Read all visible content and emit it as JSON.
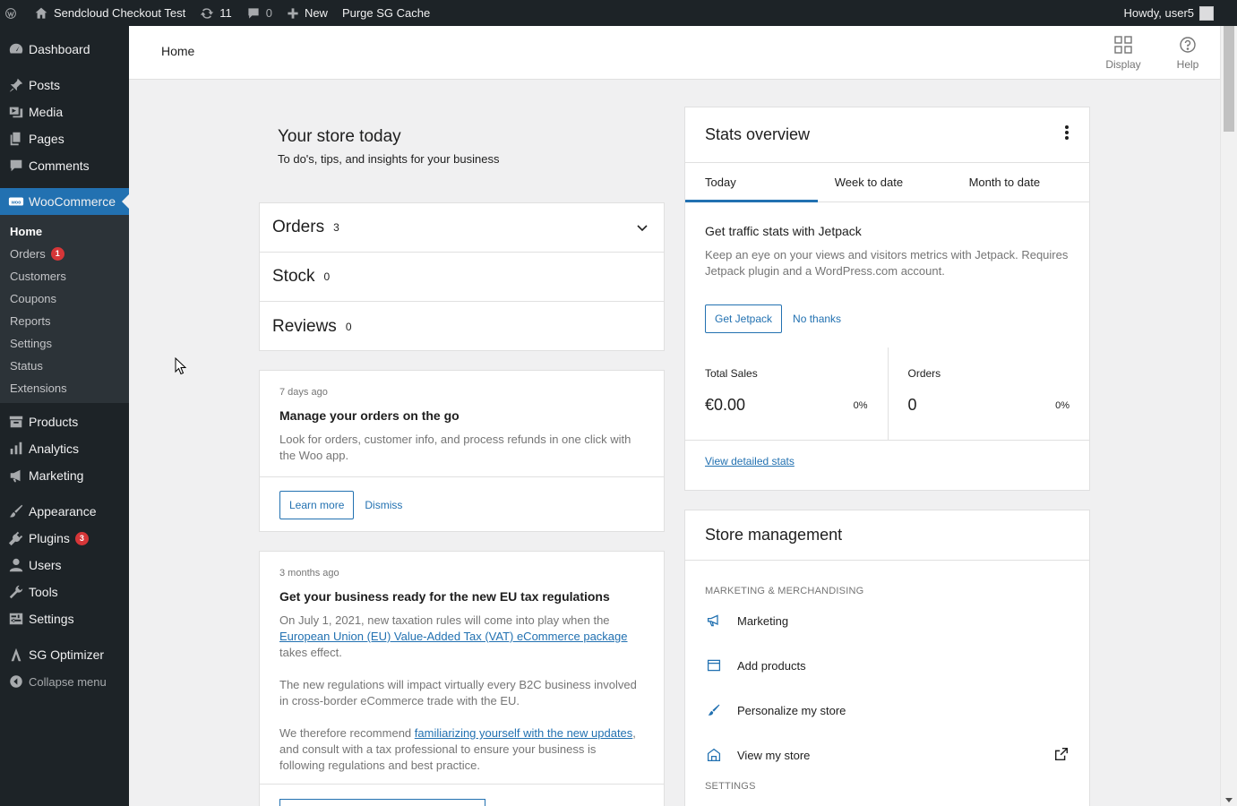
{
  "adminbar": {
    "site_name": "Sendcloud Checkout Test",
    "updates_count": "11",
    "comments_count": "0",
    "new_label": "New",
    "purge_label": "Purge SG Cache",
    "howdy": "Howdy, user5"
  },
  "sidebar": {
    "dashboard": "Dashboard",
    "posts": "Posts",
    "media": "Media",
    "pages": "Pages",
    "comments": "Comments",
    "woocommerce": "WooCommerce",
    "woo_sub": {
      "home": "Home",
      "orders": "Orders",
      "orders_badge": "1",
      "customers": "Customers",
      "coupons": "Coupons",
      "reports": "Reports",
      "settings": "Settings",
      "status": "Status",
      "extensions": "Extensions"
    },
    "products": "Products",
    "analytics": "Analytics",
    "marketing": "Marketing",
    "appearance": "Appearance",
    "plugins": "Plugins",
    "plugins_badge": "3",
    "users": "Users",
    "tools": "Tools",
    "settings": "Settings",
    "sg_optimizer": "SG Optimizer",
    "collapse": "Collapse menu"
  },
  "header": {
    "breadcrumb": "Home",
    "display_label": "Display",
    "help_label": "Help"
  },
  "store_today": {
    "title": "Your store today",
    "subtitle": "To do's, tips, and insights for your business"
  },
  "tasks": [
    {
      "label": "Orders",
      "count": "3"
    },
    {
      "label": "Stock",
      "count": "0"
    },
    {
      "label": "Reviews",
      "count": "0"
    }
  ],
  "note1": {
    "date": "7 days ago",
    "title": "Manage your orders on the go",
    "text": "Look for orders, customer info, and process refunds in one click with the Woo app.",
    "learn_more": "Learn more",
    "dismiss": "Dismiss"
  },
  "note2": {
    "date": "3 months ago",
    "title": "Get your business ready for the new EU tax regulations",
    "p1_before": "On July 1, 2021, new taxation rules will come into play when the ",
    "p1_link": "European Union (EU) Value-Added Tax (VAT) eCommerce package",
    "p1_after": " takes effect.",
    "p2": "The new regulations will impact virtually every B2C business involved in cross-border eCommerce trade with the EU.",
    "p3_before": "We therefore recommend ",
    "p3_link": "familiarizing yourself with the new updates",
    "p3_after": ", and consult with a tax professional to ensure your business is following regulations and best practice."
  },
  "stats": {
    "title": "Stats overview",
    "tabs": [
      "Today",
      "Week to date",
      "Month to date"
    ],
    "jetpack_title": "Get traffic stats with Jetpack",
    "jetpack_text": "Keep an eye on your views and visitors metrics with Jetpack. Requires Jetpack plugin and a WordPress.com account.",
    "get_jetpack": "Get Jetpack",
    "no_thanks": "No thanks",
    "total_sales_label": "Total Sales",
    "total_sales_value": "€0.00",
    "total_sales_pct": "0%",
    "orders_label": "Orders",
    "orders_value": "0",
    "orders_pct": "0%",
    "view_detailed": "View detailed stats"
  },
  "store_mgmt": {
    "title": "Store management",
    "section1": "Marketing & Merchandising",
    "items": [
      "Marketing",
      "Add products",
      "Personalize my store",
      "View my store"
    ],
    "section2": "Settings"
  }
}
